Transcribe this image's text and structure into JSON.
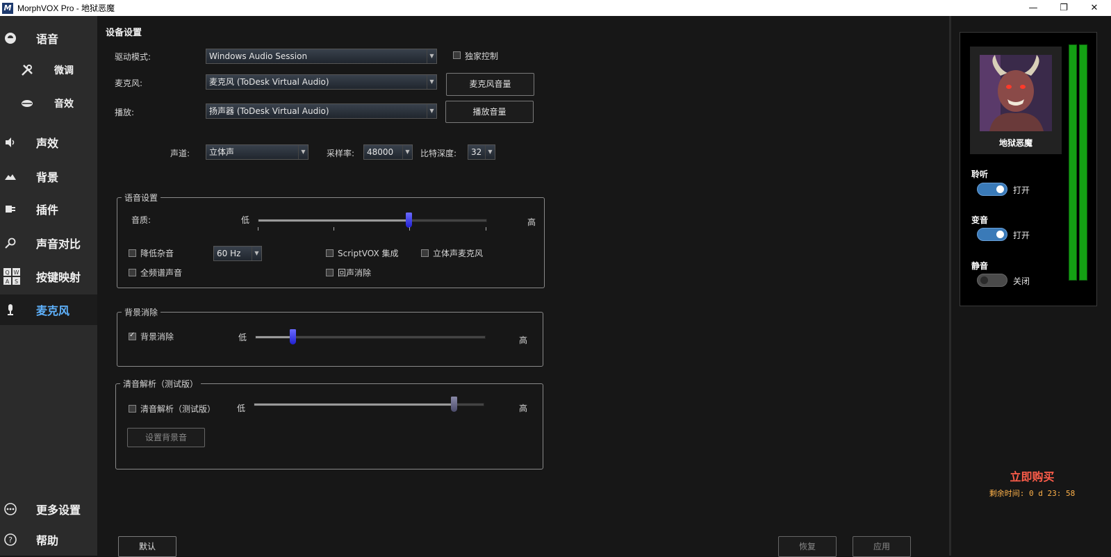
{
  "window": {
    "title": "MorphVOX Pro - 地狱恶魔",
    "icon_text": "M",
    "minimize": "—",
    "maximize": "❐",
    "close": "✕"
  },
  "sidebar": {
    "items": [
      {
        "label": "语音",
        "icon": "voice-icon"
      },
      {
        "label": "微调",
        "icon": "tools-icon"
      },
      {
        "label": "音效",
        "icon": "lips-icon"
      },
      {
        "label": "声效",
        "icon": "speaker-icon"
      },
      {
        "label": "背景",
        "icon": "landscape-icon"
      },
      {
        "label": "插件",
        "icon": "plugin-icon"
      },
      {
        "label": "声音对比",
        "icon": "magnifier-icon"
      },
      {
        "label": "按键映射",
        "icon": "keys-icon"
      },
      {
        "label": "麦克风",
        "icon": "microphone-icon"
      },
      {
        "label": "更多设置",
        "icon": "more-icon"
      },
      {
        "label": "帮助",
        "icon": "help-icon"
      }
    ],
    "keys": [
      "Q",
      "W",
      "A",
      "S"
    ]
  },
  "device": {
    "title": "设备设置",
    "driver_label": "驱动模式:",
    "driver_value": "Windows Audio Session",
    "exclusive_label": "独家控制",
    "exclusive_checked": false,
    "mic_label": "麦克风:",
    "mic_value": "麦克风 (ToDesk Virtual Audio)",
    "mic_volume_button": "麦克风音量",
    "playback_label": "播放:",
    "playback_value": "扬声器 (ToDesk Virtual Audio)",
    "playback_volume_button": "播放音量",
    "channel_label": "声道:",
    "channel_value": "立体声",
    "samplerate_label": "采样率:",
    "samplerate_value": "48000",
    "bitdepth_label": "比特深度:",
    "bitdepth_value": "32"
  },
  "voice_settings": {
    "title": "语音设置",
    "quality_label": "音质:",
    "low": "低",
    "high": "高",
    "quality_level": 0.66,
    "noise_reduction_label": "降低杂音",
    "noise_reduction_checked": false,
    "noise_freq_value": "60 Hz",
    "scriptvox_label": "ScriptVOX 集成",
    "scriptvox_checked": false,
    "stereo_mic_label": "立体声麦克风",
    "stereo_mic_checked": false,
    "full_spectrum_label": "全频谱声音",
    "full_spectrum_checked": false,
    "echo_cancel_label": "回声消除",
    "echo_cancel_checked": false
  },
  "bg_cancel": {
    "title": "背景消除",
    "checkbox_label": "背景消除",
    "checked": true,
    "low": "低",
    "high": "高",
    "level": 0.16
  },
  "clarity": {
    "title": "清音解析（测试版）",
    "checkbox_label": "清音解析（测试版）",
    "checked": false,
    "low": "低",
    "high": "高",
    "level": 0.87,
    "set_bg_button": "设置背景音"
  },
  "footer": {
    "default_button": "默认",
    "restore_button": "恢复",
    "apply_button": "应用"
  },
  "right_panel": {
    "voice_name": "地狱恶魔",
    "listen_title": "聆听",
    "listen_state": "打开",
    "listen_on": true,
    "morph_title": "变音",
    "morph_state": "打开",
    "morph_on": true,
    "mute_title": "静音",
    "mute_state": "关闭",
    "mute_on": false,
    "buy_now": "立即购买",
    "remaining": "剩余时间: 0 d 23: 58"
  },
  "colors": {
    "accent": "#5fb3ff",
    "buy": "#ff5d4a",
    "remaining": "#ffb24a",
    "meter": "#14a014"
  }
}
